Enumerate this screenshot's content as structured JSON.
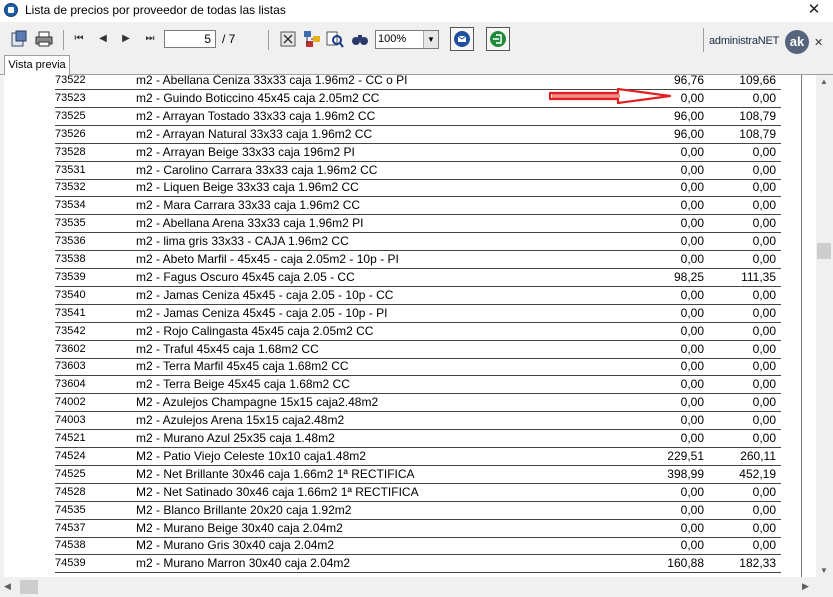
{
  "window": {
    "title": "Lista de precios por proveedor de todas las listas",
    "close": "✕"
  },
  "toolbar": {
    "page_current": "5",
    "page_total": "/ 7",
    "zoom": "100%",
    "logo_text": "administraNET",
    "logo_mark": "ak",
    "close_small": "✕",
    "icons": [
      "export-icon",
      "print-icon",
      "first-page-icon",
      "prev-page-icon",
      "next-page-icon",
      "last-page-icon",
      "cancel-icon",
      "group-tree-icon",
      "search-icon",
      "binoculars-icon",
      "email-icon",
      "exit-icon"
    ]
  },
  "tab": {
    "label": "Vista previa"
  },
  "report": {
    "rows": [
      {
        "code": "73522",
        "desc": "m2 - Abellana Ceniza 33x33 caja 1.96m2 - CC o PI",
        "p1": "96,76",
        "p2": "109,66"
      },
      {
        "code": "73523",
        "desc": "m2 - Guindo Boticcino 45x45 caja 2.05m2 CC",
        "p1": "0,00",
        "p2": "0,00"
      },
      {
        "code": "73525",
        "desc": "m2 - Arrayan Tostado 33x33 caja 1.96m2 CC",
        "p1": "96,00",
        "p2": "108,79"
      },
      {
        "code": "73526",
        "desc": "m2 - Arrayan Natural 33x33 caja 1.96m2 CC",
        "p1": "96,00",
        "p2": "108,79"
      },
      {
        "code": "73528",
        "desc": "m2 - Arrayan Beige 33x33 caja 196m2 PI",
        "p1": "0,00",
        "p2": "0,00"
      },
      {
        "code": "73531",
        "desc": "m2 - Carolino Carrara 33x33 caja 1.96m2 CC",
        "p1": "0,00",
        "p2": "0,00"
      },
      {
        "code": "73532",
        "desc": "m2 - Liquen Beige 33x33 caja 1.96m2 CC",
        "p1": "0,00",
        "p2": "0,00"
      },
      {
        "code": "73534",
        "desc": "m2 - Mara Carrara 33x33 caja 1.96m2 CC",
        "p1": "0,00",
        "p2": "0,00"
      },
      {
        "code": "73535",
        "desc": "m2 - Abellana Arena 33x33 caja 1.96m2 PI",
        "p1": "0,00",
        "p2": "0,00"
      },
      {
        "code": "73536",
        "desc": "m2 - lima gris 33x33 - CAJA 1.96m2 CC",
        "p1": "0,00",
        "p2": "0,00"
      },
      {
        "code": "73538",
        "desc": "m2 - Abeto Marfil - 45x45 - caja 2.05m2 - 10p - PI",
        "p1": "0,00",
        "p2": "0,00"
      },
      {
        "code": "73539",
        "desc": "m2 - Fagus Oscuro 45x45 caja 2.05 - CC",
        "p1": "98,25",
        "p2": "111,35"
      },
      {
        "code": "73540",
        "desc": "m2 - Jamas Ceniza 45x45 - caja 2.05 - 10p - CC",
        "p1": "0,00",
        "p2": "0,00"
      },
      {
        "code": "73541",
        "desc": "m2 - Jamas Ceniza 45x45 - caja 2.05 - 10p - PI",
        "p1": "0,00",
        "p2": "0,00"
      },
      {
        "code": "73542",
        "desc": "m2 - Rojo Calingasta 45x45 caja 2.05m2 CC",
        "p1": "0,00",
        "p2": "0,00"
      },
      {
        "code": "73602",
        "desc": "m2 - Traful 45x45 caja 1.68m2 CC",
        "p1": "0,00",
        "p2": "0,00"
      },
      {
        "code": "73603",
        "desc": "m2 - Terra Marfil 45x45 caja 1.68m2 CC",
        "p1": "0,00",
        "p2": "0,00"
      },
      {
        "code": "73604",
        "desc": "m2 - Terra Beige 45x45 caja 1.68m2 CC",
        "p1": "0,00",
        "p2": "0,00"
      },
      {
        "code": "74002",
        "desc": "M2 - Azulejos Champagne 15x15 caja2.48m2",
        "p1": "0,00",
        "p2": "0,00"
      },
      {
        "code": "74003",
        "desc": "m2 - Azulejos Arena 15x15 caja2.48m2",
        "p1": "0,00",
        "p2": "0,00"
      },
      {
        "code": "74521",
        "desc": "m2 - Murano Azul 25x35 caja 1.48m2",
        "p1": "0,00",
        "p2": "0,00"
      },
      {
        "code": "74524",
        "desc": "M2 - Patio Viejo Celeste 10x10 caja1.48m2",
        "p1": "229,51",
        "p2": "260,11"
      },
      {
        "code": "74525",
        "desc": "M2 - Net Brillante 30x46 caja 1.66m2 1ª RECTIFICA",
        "p1": "398,99",
        "p2": "452,19"
      },
      {
        "code": "74528",
        "desc": "M2 - Net Satinado 30x46 caja 1.66m2 1ª RECTIFICA",
        "p1": "0,00",
        "p2": "0,00"
      },
      {
        "code": "74535",
        "desc": "M2 - Blanco Brillante 20x20 caja 1.92m2",
        "p1": "0,00",
        "p2": "0,00"
      },
      {
        "code": "74537",
        "desc": "M2 - Murano Beige 30x40 caja 2.04m2",
        "p1": "0,00",
        "p2": "0,00"
      },
      {
        "code": "74538",
        "desc": "M2 - Murano Gris 30x40 caja 2.04m2",
        "p1": "0,00",
        "p2": "0,00"
      },
      {
        "code": "74539",
        "desc": "m2 - Murano Marron 30x40 caja 2.04m2",
        "p1": "160,88",
        "p2": "182,33"
      }
    ]
  },
  "annotation": {
    "arrow_color": "#e02020",
    "icon": "red-arrow-icon"
  }
}
